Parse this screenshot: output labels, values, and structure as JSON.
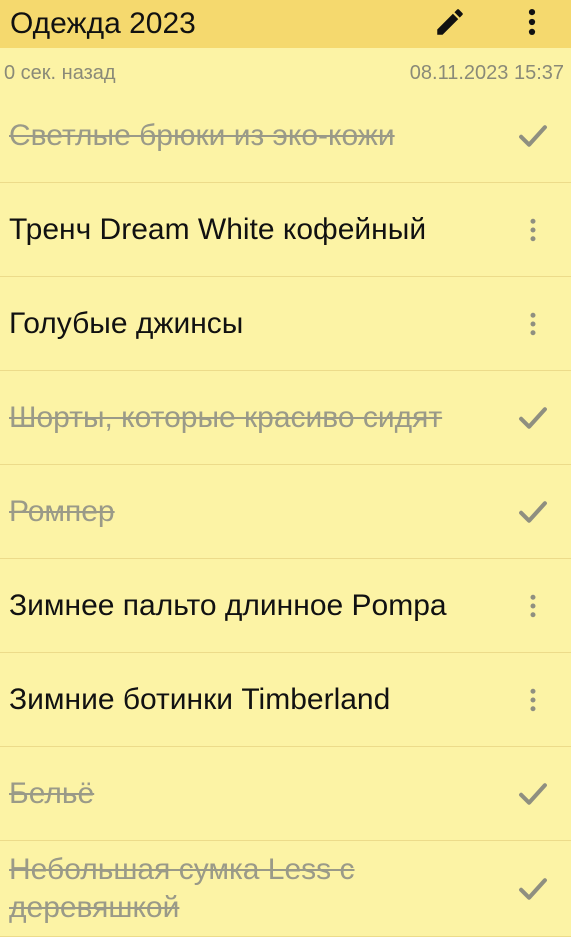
{
  "header": {
    "title": "Одежда 2023",
    "edit_icon": "pencil-icon",
    "menu_icon": "more-vertical-icon",
    "background": "#F5D96E"
  },
  "meta": {
    "relative_time": "0 сек. назад",
    "timestamp": "08.11.2023 15:37"
  },
  "colors": {
    "background": "#FCF3A5",
    "divider": "#ECDB8A",
    "done_text": "#9a9a88",
    "active_text": "#111111"
  },
  "items": [
    {
      "label": "Светлые брюки из эко-кожи",
      "done": true,
      "action_icon": "check-icon"
    },
    {
      "label": "Тренч Dream White кофейный",
      "done": false,
      "action_icon": "more-vertical-icon"
    },
    {
      "label": "Голубые джинсы",
      "done": false,
      "action_icon": "more-vertical-icon"
    },
    {
      "label": "Шорты, которые красиво сидят",
      "done": true,
      "action_icon": "check-icon"
    },
    {
      "label": "Ромпер",
      "done": true,
      "action_icon": "check-icon"
    },
    {
      "label": "Зимнее пальто длинное Pompa",
      "done": false,
      "action_icon": "more-vertical-icon"
    },
    {
      "label": "Зимние ботинки Timberland",
      "done": false,
      "action_icon": "more-vertical-icon"
    },
    {
      "label": "Бельё",
      "done": true,
      "action_icon": "check-icon"
    },
    {
      "label": "Небольшая сумка Less с деревяшкой",
      "done": true,
      "action_icon": "check-icon"
    }
  ]
}
